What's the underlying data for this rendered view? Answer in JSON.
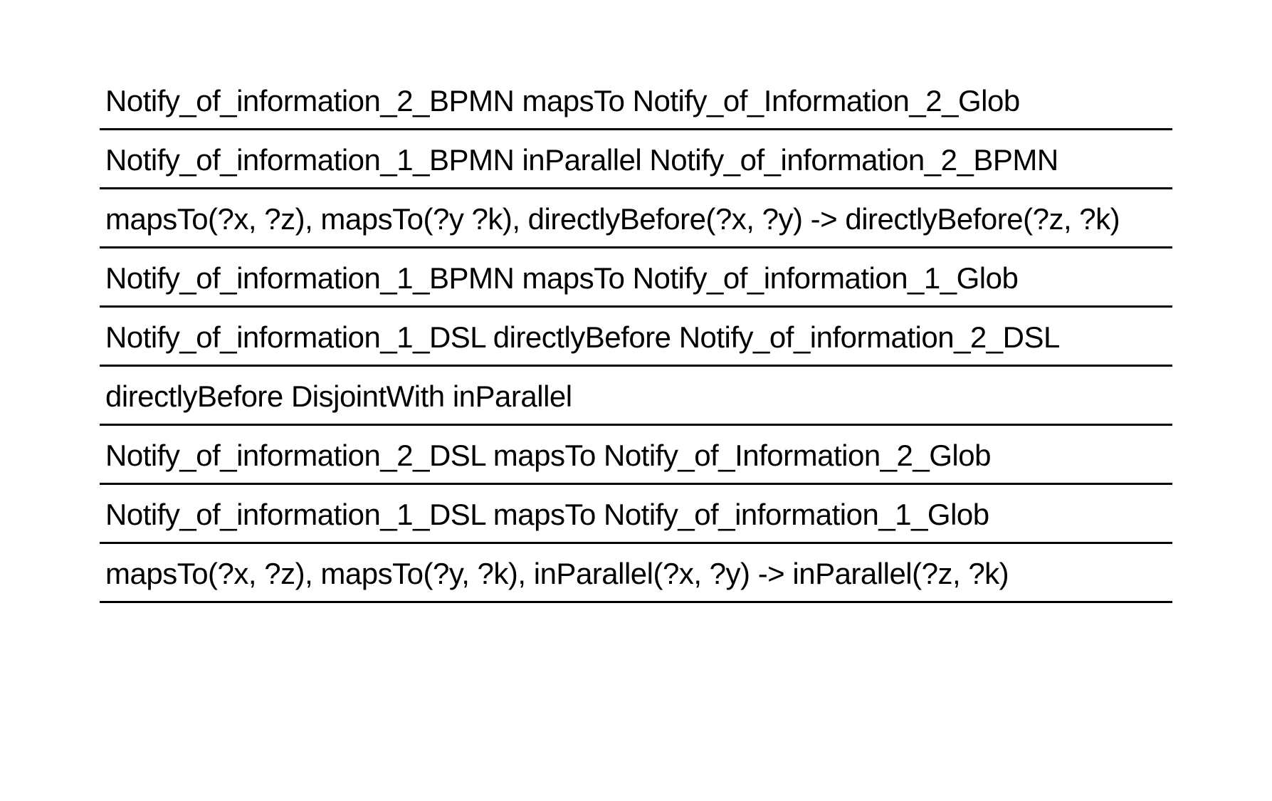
{
  "rows": [
    "Notify_of_information_2_BPMN mapsTo Notify_of_Information_2_Glob",
    "Notify_of_information_1_BPMN inParallel Notify_of_information_2_BPMN",
    "mapsTo(?x, ?z), mapsTo(?y ?k), directlyBefore(?x, ?y) -> directlyBefore(?z, ?k)",
    "Notify_of_information_1_BPMN mapsTo Notify_of_information_1_Glob",
    "Notify_of_information_1_DSL directlyBefore Notify_of_information_2_DSL",
    "directlyBefore DisjointWith inParallel",
    "Notify_of_information_2_DSL mapsTo Notify_of_Information_2_Glob",
    "Notify_of_information_1_DSL mapsTo Notify_of_information_1_Glob",
    "mapsTo(?x, ?z), mapsTo(?y, ?k), inParallel(?x, ?y) -> inParallel(?z, ?k)"
  ]
}
